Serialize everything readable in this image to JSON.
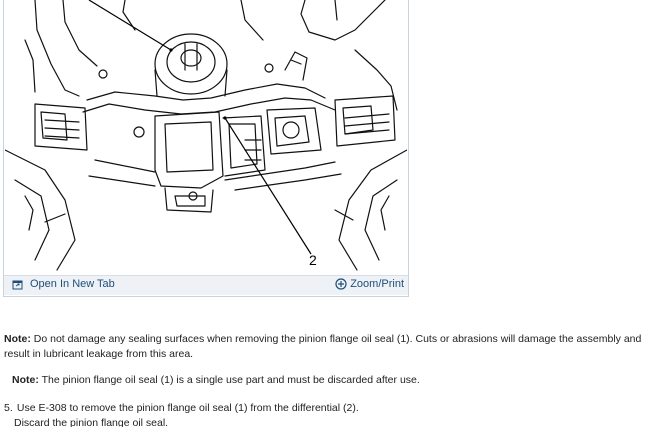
{
  "figure": {
    "callouts": {
      "two": "2"
    },
    "toolbar": {
      "open_new_tab": "Open In New Tab",
      "zoom_print": "Zoom/Print",
      "link_color": "#1f4e79"
    },
    "icons": {
      "open_new_tab": "open-new-tab-icon",
      "zoom_print": "zoom-plus-icon"
    }
  },
  "notes": [
    {
      "label": "Note:",
      "text": " Do not damage any sealing surfaces when removing the pinion flange oil seal (1). Cuts or abrasions will damage the assembly and result in lubricant leakage from this area."
    },
    {
      "label": "Note:",
      "text": " The pinion flange oil seal (1) is a single use part and must be discarded after use."
    }
  ],
  "steps": [
    {
      "number": "5.",
      "text": "Use E-308 to remove the pinion flange oil seal (1) from the differential (2).",
      "sub": "Discard the pinion flange oil seal."
    }
  ]
}
